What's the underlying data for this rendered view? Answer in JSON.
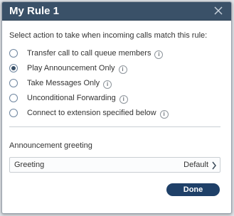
{
  "dialog": {
    "title": "My Rule 1",
    "prompt": "Select action to take when incoming calls match this rule:",
    "options": [
      {
        "label": "Transfer call to call queue members",
        "checked": false
      },
      {
        "label": "Play Announcement Only",
        "checked": true
      },
      {
        "label": "Take Messages Only",
        "checked": false
      },
      {
        "label": "Unconditional Forwarding",
        "checked": false
      },
      {
        "label": "Connect to extension specified below",
        "checked": false
      }
    ],
    "info_glyph": "i",
    "section_title": "Announcement greeting",
    "greeting_row": {
      "label": "Greeting",
      "value": "Default"
    },
    "done_label": "Done"
  },
  "colors": {
    "titlebar": "#3a5168",
    "done_button": "#1f4068"
  }
}
